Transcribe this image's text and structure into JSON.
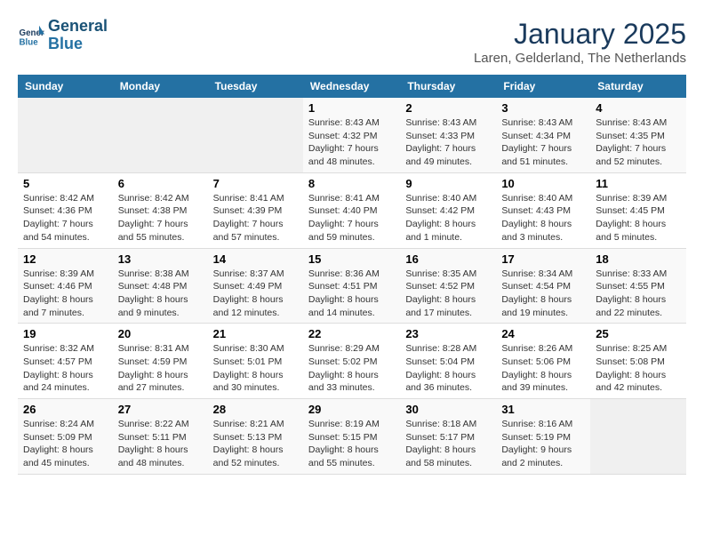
{
  "logo": {
    "line1": "General",
    "line2": "Blue"
  },
  "title": "January 2025",
  "location": "Laren, Gelderland, The Netherlands",
  "days_header": [
    "Sunday",
    "Monday",
    "Tuesday",
    "Wednesday",
    "Thursday",
    "Friday",
    "Saturday"
  ],
  "weeks": [
    [
      {
        "day": "",
        "details": ""
      },
      {
        "day": "",
        "details": ""
      },
      {
        "day": "",
        "details": ""
      },
      {
        "day": "1",
        "details": "Sunrise: 8:43 AM\nSunset: 4:32 PM\nDaylight: 7 hours\nand 48 minutes."
      },
      {
        "day": "2",
        "details": "Sunrise: 8:43 AM\nSunset: 4:33 PM\nDaylight: 7 hours\nand 49 minutes."
      },
      {
        "day": "3",
        "details": "Sunrise: 8:43 AM\nSunset: 4:34 PM\nDaylight: 7 hours\nand 51 minutes."
      },
      {
        "day": "4",
        "details": "Sunrise: 8:43 AM\nSunset: 4:35 PM\nDaylight: 7 hours\nand 52 minutes."
      }
    ],
    [
      {
        "day": "5",
        "details": "Sunrise: 8:42 AM\nSunset: 4:36 PM\nDaylight: 7 hours\nand 54 minutes."
      },
      {
        "day": "6",
        "details": "Sunrise: 8:42 AM\nSunset: 4:38 PM\nDaylight: 7 hours\nand 55 minutes."
      },
      {
        "day": "7",
        "details": "Sunrise: 8:41 AM\nSunset: 4:39 PM\nDaylight: 7 hours\nand 57 minutes."
      },
      {
        "day": "8",
        "details": "Sunrise: 8:41 AM\nSunset: 4:40 PM\nDaylight: 7 hours\nand 59 minutes."
      },
      {
        "day": "9",
        "details": "Sunrise: 8:40 AM\nSunset: 4:42 PM\nDaylight: 8 hours\nand 1 minute."
      },
      {
        "day": "10",
        "details": "Sunrise: 8:40 AM\nSunset: 4:43 PM\nDaylight: 8 hours\nand 3 minutes."
      },
      {
        "day": "11",
        "details": "Sunrise: 8:39 AM\nSunset: 4:45 PM\nDaylight: 8 hours\nand 5 minutes."
      }
    ],
    [
      {
        "day": "12",
        "details": "Sunrise: 8:39 AM\nSunset: 4:46 PM\nDaylight: 8 hours\nand 7 minutes."
      },
      {
        "day": "13",
        "details": "Sunrise: 8:38 AM\nSunset: 4:48 PM\nDaylight: 8 hours\nand 9 minutes."
      },
      {
        "day": "14",
        "details": "Sunrise: 8:37 AM\nSunset: 4:49 PM\nDaylight: 8 hours\nand 12 minutes."
      },
      {
        "day": "15",
        "details": "Sunrise: 8:36 AM\nSunset: 4:51 PM\nDaylight: 8 hours\nand 14 minutes."
      },
      {
        "day": "16",
        "details": "Sunrise: 8:35 AM\nSunset: 4:52 PM\nDaylight: 8 hours\nand 17 minutes."
      },
      {
        "day": "17",
        "details": "Sunrise: 8:34 AM\nSunset: 4:54 PM\nDaylight: 8 hours\nand 19 minutes."
      },
      {
        "day": "18",
        "details": "Sunrise: 8:33 AM\nSunset: 4:55 PM\nDaylight: 8 hours\nand 22 minutes."
      }
    ],
    [
      {
        "day": "19",
        "details": "Sunrise: 8:32 AM\nSunset: 4:57 PM\nDaylight: 8 hours\nand 24 minutes."
      },
      {
        "day": "20",
        "details": "Sunrise: 8:31 AM\nSunset: 4:59 PM\nDaylight: 8 hours\nand 27 minutes."
      },
      {
        "day": "21",
        "details": "Sunrise: 8:30 AM\nSunset: 5:01 PM\nDaylight: 8 hours\nand 30 minutes."
      },
      {
        "day": "22",
        "details": "Sunrise: 8:29 AM\nSunset: 5:02 PM\nDaylight: 8 hours\nand 33 minutes."
      },
      {
        "day": "23",
        "details": "Sunrise: 8:28 AM\nSunset: 5:04 PM\nDaylight: 8 hours\nand 36 minutes."
      },
      {
        "day": "24",
        "details": "Sunrise: 8:26 AM\nSunset: 5:06 PM\nDaylight: 8 hours\nand 39 minutes."
      },
      {
        "day": "25",
        "details": "Sunrise: 8:25 AM\nSunset: 5:08 PM\nDaylight: 8 hours\nand 42 minutes."
      }
    ],
    [
      {
        "day": "26",
        "details": "Sunrise: 8:24 AM\nSunset: 5:09 PM\nDaylight: 8 hours\nand 45 minutes."
      },
      {
        "day": "27",
        "details": "Sunrise: 8:22 AM\nSunset: 5:11 PM\nDaylight: 8 hours\nand 48 minutes."
      },
      {
        "day": "28",
        "details": "Sunrise: 8:21 AM\nSunset: 5:13 PM\nDaylight: 8 hours\nand 52 minutes."
      },
      {
        "day": "29",
        "details": "Sunrise: 8:19 AM\nSunset: 5:15 PM\nDaylight: 8 hours\nand 55 minutes."
      },
      {
        "day": "30",
        "details": "Sunrise: 8:18 AM\nSunset: 5:17 PM\nDaylight: 8 hours\nand 58 minutes."
      },
      {
        "day": "31",
        "details": "Sunrise: 8:16 AM\nSunset: 5:19 PM\nDaylight: 9 hours\nand 2 minutes."
      },
      {
        "day": "",
        "details": ""
      }
    ]
  ]
}
